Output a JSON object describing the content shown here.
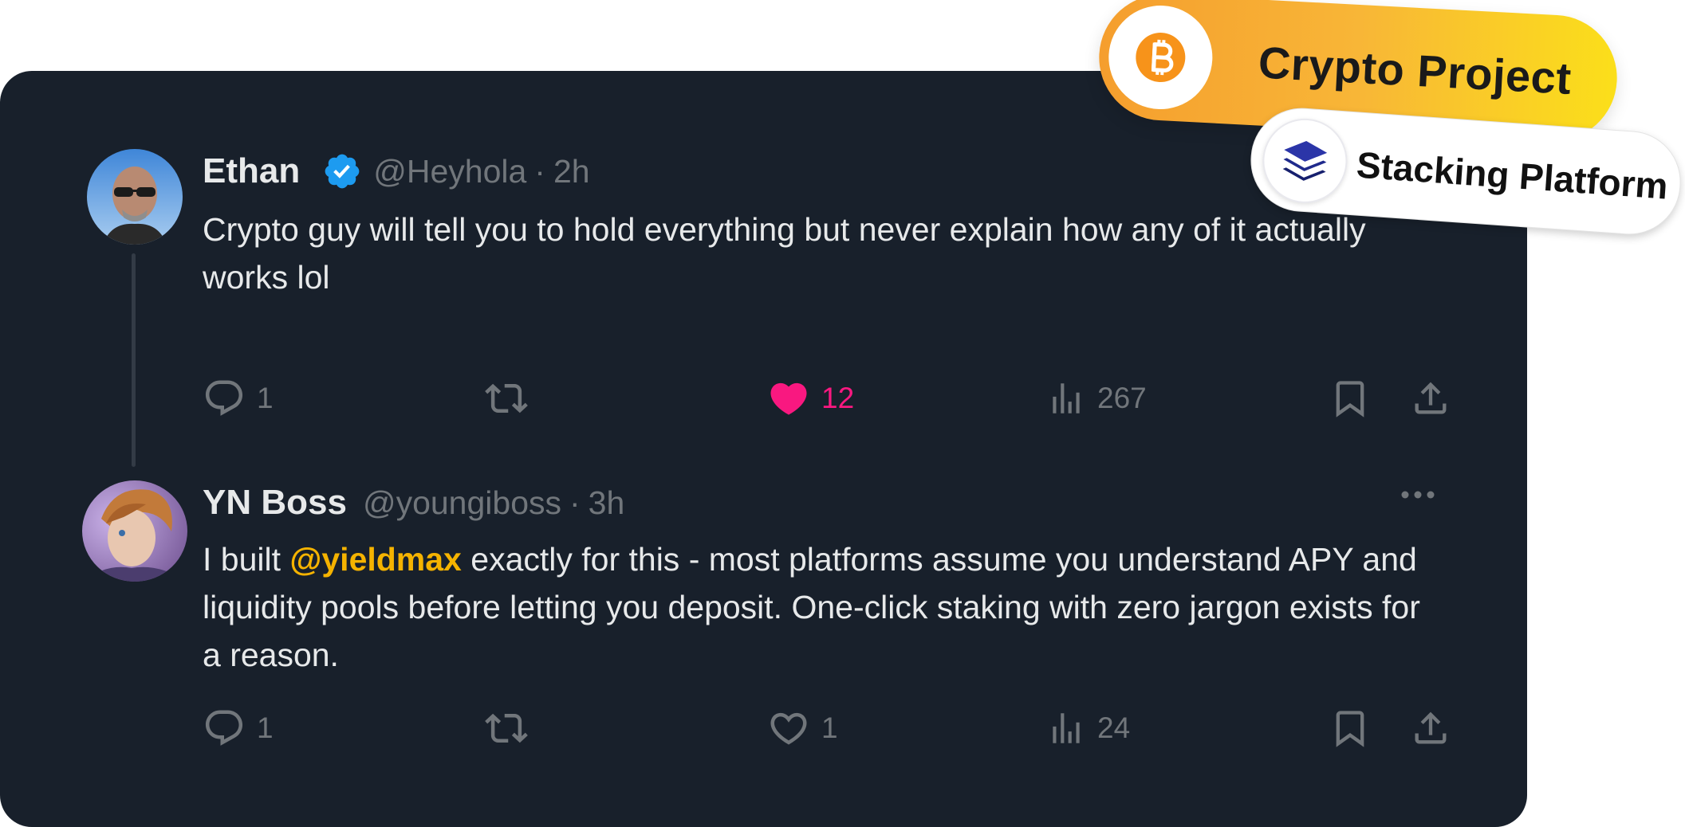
{
  "colors": {
    "card_bg": "#18202b",
    "text_primary": "#e7e9ea",
    "text_muted": "#71767b",
    "verified_blue": "#1d9bf0",
    "like_pink": "#f91880",
    "mention_gold": "#f5b300",
    "badge_orange": "#f59e2e",
    "badge_yellow": "#fbdf1a",
    "stack_navy": "#1f2a8c"
  },
  "badges": {
    "crypto": {
      "label": "Crypto Project",
      "icon": "bitcoin-icon"
    },
    "stacking": {
      "label": "Stacking Platform",
      "icon": "layers-icon"
    }
  },
  "tweets": [
    {
      "name": "Ethan",
      "verified": true,
      "handle": "@Heyhola",
      "separator": "·",
      "time": "2h",
      "text": "Crypto guy will tell you to hold everything but never explain how any of it actually works lol",
      "actions": {
        "reply_count": "1",
        "retweet_count": "",
        "like_count": "12",
        "liked": true,
        "views_count": "267"
      }
    },
    {
      "name": "YN Boss",
      "verified": false,
      "handle": "@youngiboss",
      "separator": "·",
      "time": "3h",
      "text_before": "I built ",
      "mention": "@yieldmax",
      "text_after": " exactly for this - most platforms assume you understand APY and liquidity pools before letting you deposit. One-click staking with zero jargon exists for a reason.",
      "actions": {
        "reply_count": "1",
        "retweet_count": "",
        "like_count": "1",
        "liked": false,
        "views_count": "24"
      }
    }
  ]
}
